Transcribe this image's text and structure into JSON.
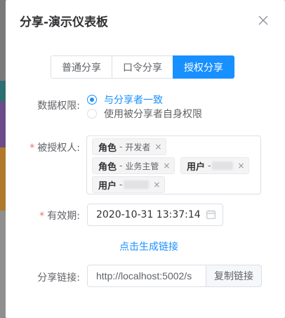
{
  "dialog": {
    "title": "分享-演示仪表板"
  },
  "share_tabs": [
    {
      "label": "普通分享",
      "active": false
    },
    {
      "label": "口令分享",
      "active": false
    },
    {
      "label": "授权分享",
      "active": true
    }
  ],
  "permission": {
    "label": "数据权限:",
    "options": [
      {
        "label": "与分享者一致",
        "checked": true
      },
      {
        "label": "使用被分享者自身权限",
        "checked": false
      }
    ]
  },
  "grantees": {
    "label": "被授权人:",
    "required_mark": "*",
    "tags": [
      {
        "type": "角色",
        "sep": "-",
        "value": "开发者"
      },
      {
        "type": "角色",
        "sep": "-",
        "value": "业务主管"
      },
      {
        "type": "用户",
        "sep": "-",
        "value": ""
      },
      {
        "type": "用户",
        "sep": "-",
        "value": ""
      }
    ],
    "tag_close_glyph": "×"
  },
  "expiry": {
    "label": "有效期:",
    "required_mark": "*",
    "value": "2020-10-31 13:37:14"
  },
  "generate_link_label": "点击生成链接",
  "share_link": {
    "label": "分享链接:",
    "url": "http://localhost:5002/s",
    "copy_label": "复制链接"
  },
  "colors": {
    "primary": "#1890ff",
    "required": "#f56c6c"
  }
}
